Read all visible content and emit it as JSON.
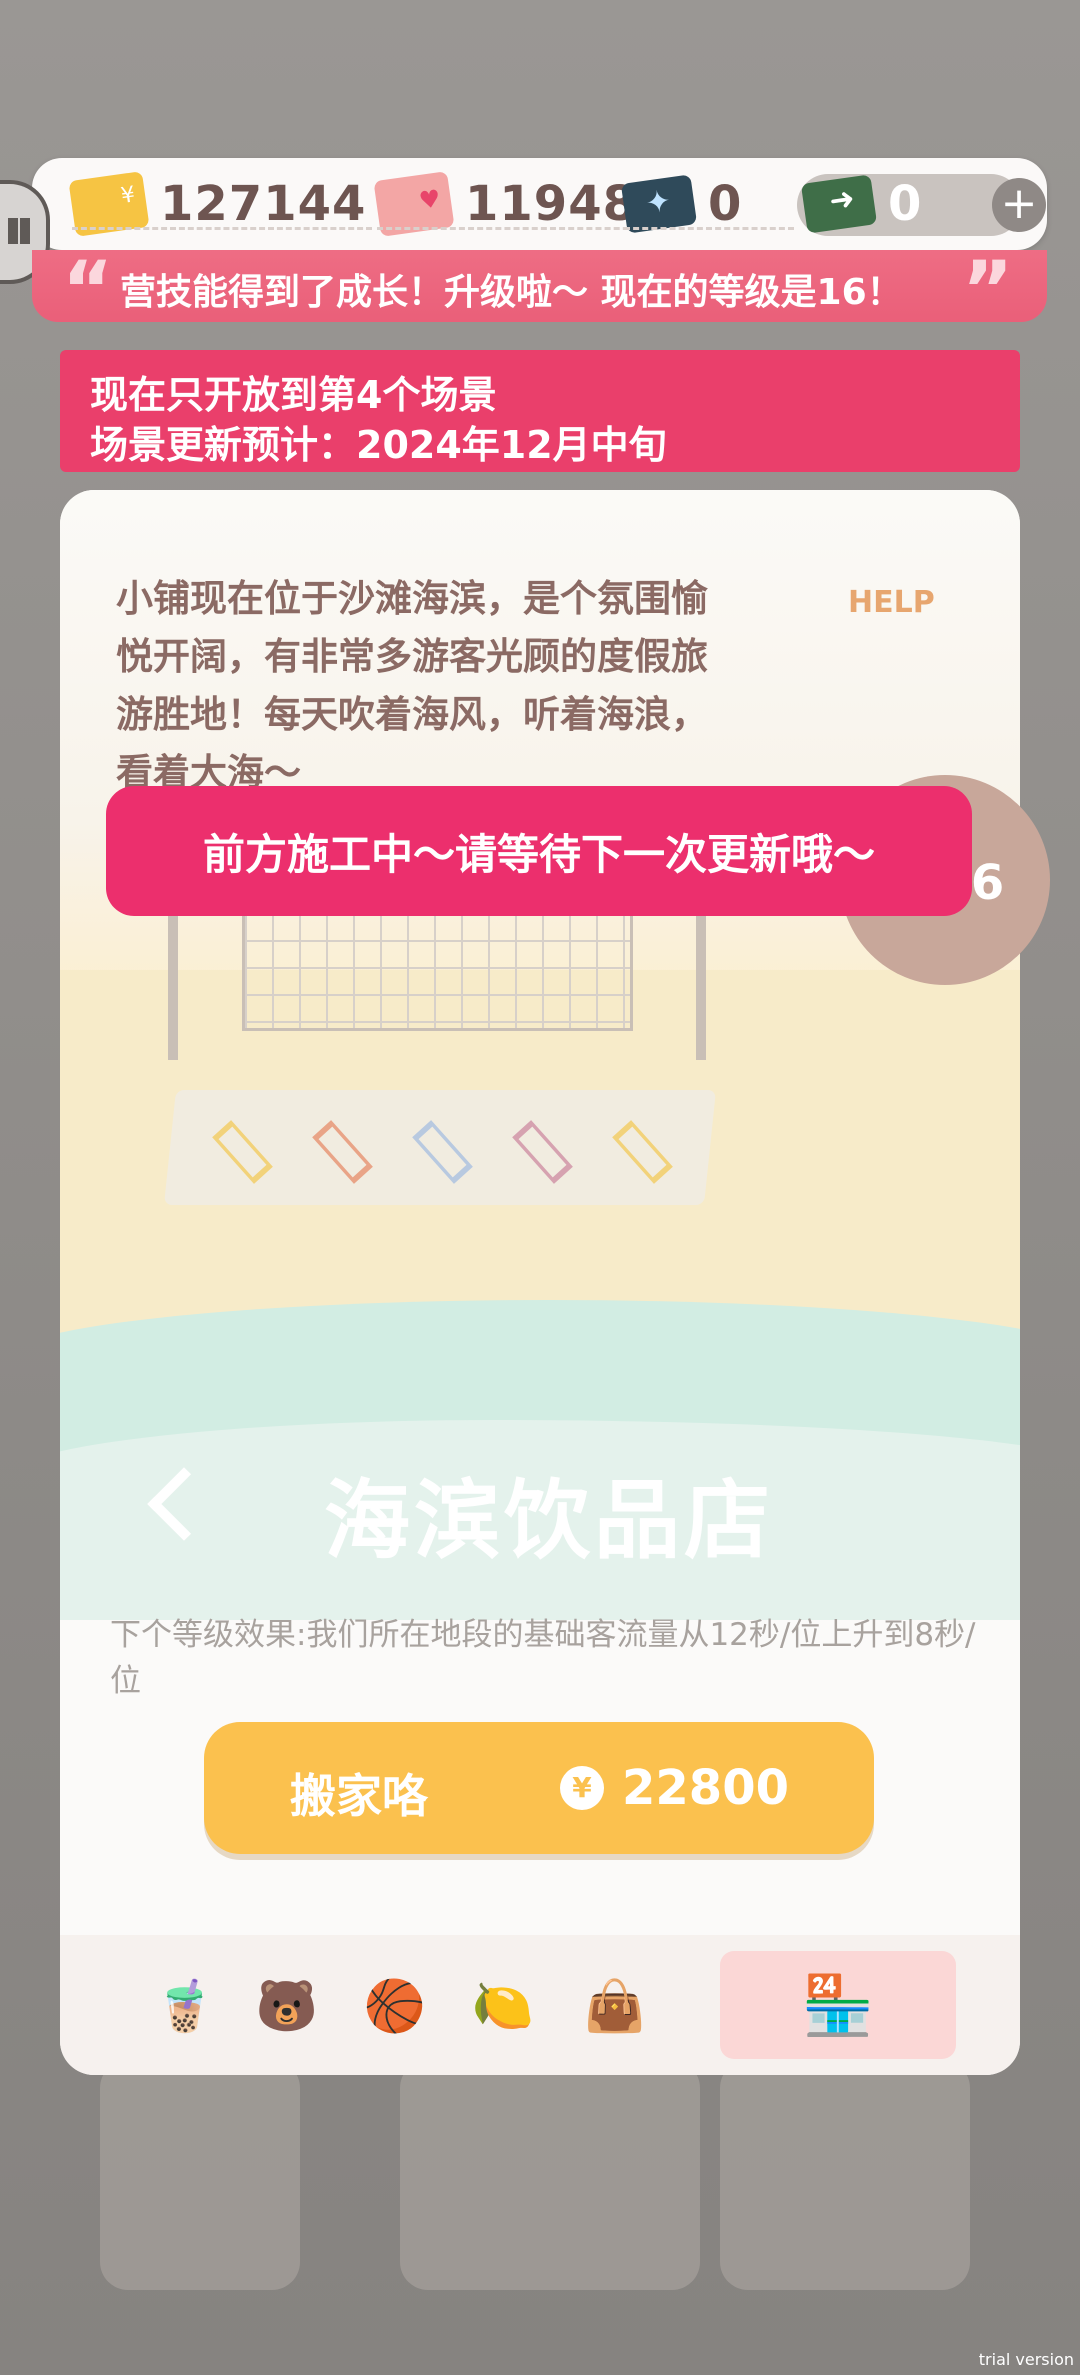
{
  "currency": {
    "gold": "127144",
    "heart": "11948",
    "ticket": "0",
    "cash": "0"
  },
  "level_message": "营技能得到了成长！升级啦～ 现在的等级是16！",
  "notice": {
    "line1": "现在只开放到第4个场景",
    "line2": "场景更新预计：2024年12月中旬"
  },
  "scene": {
    "description": "小铺现在位于沙滩海滨，是个氛围愉悦开阔，有非常多游客光顾的度假旅游胜地！每天吹着海风，听着海浪，看着大海～",
    "help": "HELP",
    "shop_name": "海滨饮品店",
    "page": "4/6"
  },
  "toast": "前方施工中～请等待下一次更新哦～",
  "next_level_effect": "下个等级效果:我们所在地段的基础客流量从12秒/位上升到8秒/位",
  "move_button": {
    "label": "搬家咯",
    "cost": "22800",
    "coin_symbol": "¥"
  },
  "tabs": [
    "drink-icon",
    "bear-icon",
    "basketball-icon",
    "lemon-icon",
    "bag-icon",
    "shop-icon"
  ],
  "watermark": "trial version"
}
